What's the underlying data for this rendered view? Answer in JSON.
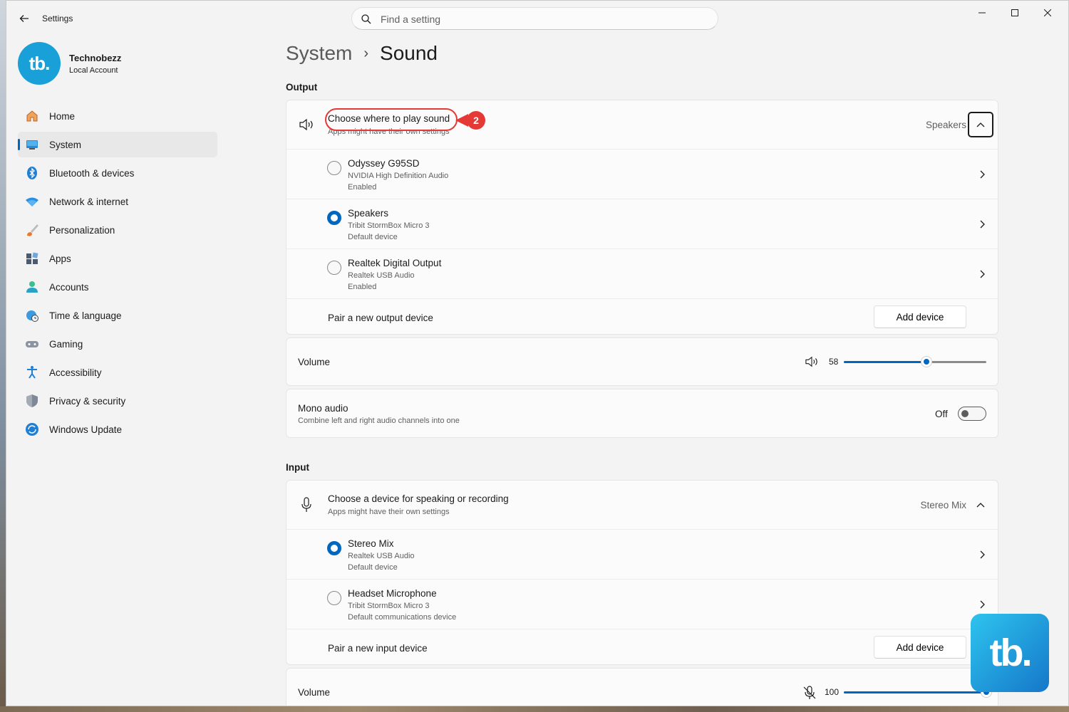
{
  "app": {
    "title": "Settings"
  },
  "search": {
    "placeholder": "Find a setting"
  },
  "profile": {
    "initials": "tb.",
    "name": "Technobezz",
    "account_type": "Local Account"
  },
  "sidebar": {
    "items": [
      {
        "label": "Home",
        "icon": "home-icon"
      },
      {
        "label": "System",
        "icon": "system-icon",
        "active": true
      },
      {
        "label": "Bluetooth & devices",
        "icon": "bluetooth-icon"
      },
      {
        "label": "Network & internet",
        "icon": "wifi-icon"
      },
      {
        "label": "Personalization",
        "icon": "brush-icon"
      },
      {
        "label": "Apps",
        "icon": "apps-icon"
      },
      {
        "label": "Accounts",
        "icon": "person-icon"
      },
      {
        "label": "Time & language",
        "icon": "globe-clock-icon"
      },
      {
        "label": "Gaming",
        "icon": "gamepad-icon"
      },
      {
        "label": "Accessibility",
        "icon": "accessibility-icon"
      },
      {
        "label": "Privacy & security",
        "icon": "shield-icon"
      },
      {
        "label": "Windows Update",
        "icon": "update-icon"
      }
    ]
  },
  "breadcrumb": {
    "parent": "System",
    "separator": "›",
    "current": "Sound"
  },
  "output": {
    "section_label": "Output",
    "chooser": {
      "title": "Choose where to play sound",
      "subtitle": "Apps might have their own settings",
      "selected": "Speakers"
    },
    "devices": [
      {
        "name": "Odyssey G95SD",
        "driver": "NVIDIA High Definition Audio",
        "status": "Enabled",
        "selected": false
      },
      {
        "name": "Speakers",
        "driver": "Tribit StormBox Micro 3",
        "status": "Default device",
        "selected": true
      },
      {
        "name": "Realtek Digital Output",
        "driver": "Realtek USB Audio",
        "status": "Enabled",
        "selected": false
      }
    ],
    "pair": {
      "label": "Pair a new output device",
      "button": "Add device"
    },
    "volume": {
      "label": "Volume",
      "value": "58",
      "level": 58
    },
    "mono": {
      "title": "Mono audio",
      "subtitle": "Combine left and right audio channels into one",
      "state": "Off"
    }
  },
  "input": {
    "section_label": "Input",
    "chooser": {
      "title": "Choose a device for speaking or recording",
      "subtitle": "Apps might have their own settings",
      "selected": "Stereo Mix"
    },
    "devices": [
      {
        "name": "Stereo Mix",
        "driver": "Realtek USB Audio",
        "status": "Default device",
        "selected": true
      },
      {
        "name": "Headset Microphone",
        "driver": "Tribit StormBox Micro 3",
        "status": "Default communications device",
        "selected": false
      }
    ],
    "pair": {
      "label": "Pair a new input device",
      "button": "Add device"
    },
    "volume": {
      "label": "Volume",
      "value": "100",
      "level": 100
    }
  },
  "annotation": {
    "step": "2"
  },
  "watermark": {
    "text": "tb."
  },
  "colors": {
    "accent": "#0067c0",
    "annotation": "#e53935",
    "brand": "#1aa0d8"
  }
}
